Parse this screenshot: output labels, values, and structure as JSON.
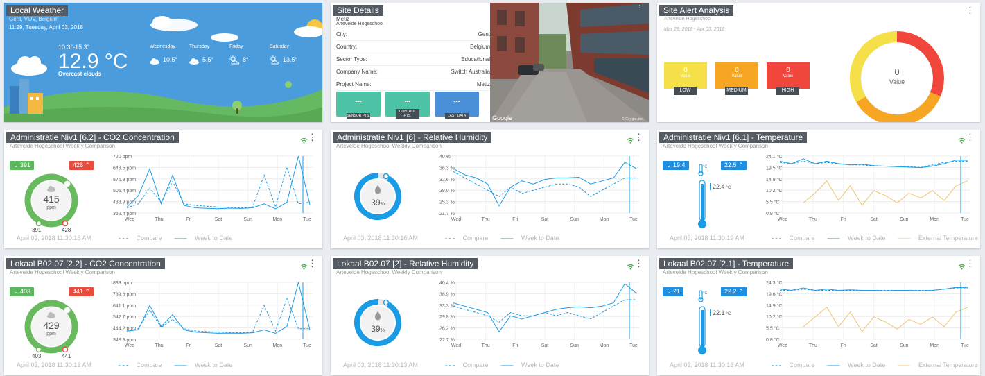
{
  "weather": {
    "title": "Local Weather",
    "location": "Gent, VOV, Belgium",
    "datetime": "11:29, Tuesday, April 03, 2018",
    "range": "10.3°-15.3°",
    "temp": "12.9 °C",
    "condition": "Overcast clouds",
    "forecast": [
      {
        "day": "Wednesday",
        "temp": "10.5°",
        "icon": "cloud-icon"
      },
      {
        "day": "Thursday",
        "temp": "5.5°",
        "icon": "cloud-icon"
      },
      {
        "day": "Friday",
        "temp": "8°",
        "icon": "sun-cloud-icon"
      },
      {
        "day": "Saturday",
        "temp": "13.5°",
        "icon": "sun-cloud-icon"
      }
    ],
    "colors": {
      "sky": "#4a9cdc",
      "grass": "#65b960"
    }
  },
  "site_details": {
    "title": "Site Details",
    "name": "Metiz",
    "subname": "Artevelde Hogeschool",
    "rows": [
      {
        "label": "City:",
        "value": "Gent"
      },
      {
        "label": "Country:",
        "value": "Belgium"
      },
      {
        "label": "Sector Type:",
        "value": "Educational"
      },
      {
        "label": "Company Name:",
        "value": "Switch Australia"
      },
      {
        "label": "Project Name:",
        "value": "Metiz"
      }
    ],
    "buttons": [
      {
        "value": "---",
        "label": "SENSOR PTS.",
        "color": "#4cc3a4"
      },
      {
        "value": "---",
        "label": "CONTROL PTS.",
        "color": "#4cc3a4"
      },
      {
        "value": "---",
        "label": "LAST DATA",
        "color": "#4a90d9"
      }
    ],
    "map_credit": "Google",
    "map_copyright": "© Google, Inc."
  },
  "alerts": {
    "title": "Site Alert Analysis",
    "subtitle": "Artevelde Hogeschool",
    "daterange": "Mar 28, 2018 - Apr 03, 2018",
    "boxes": [
      {
        "value": "0",
        "sub": "Value",
        "label": "LOW",
        "color": "#f5e04a"
      },
      {
        "value": "0",
        "sub": "Value",
        "label": "MEDIUM",
        "color": "#f7a623"
      },
      {
        "value": "0",
        "sub": "Value",
        "label": "HIGH",
        "color": "#f0463c"
      }
    ],
    "donut_value": "0",
    "donut_label": "Value"
  },
  "legend": {
    "compare": "Compare",
    "week": "Week to Date",
    "external": "External Temperature"
  },
  "days": [
    "Wed",
    "Thu",
    "Fri",
    "Sat",
    "Sun",
    "Mon",
    "Tue"
  ],
  "widgets": [
    {
      "title": "Administratie Niv1 [6.2] - CO2 Concentration",
      "subtitle": "Artevelde Hogeschool Weekly Comparison",
      "min": "391",
      "max": "428",
      "value": "415",
      "unit": "ppm",
      "low": "391",
      "high": "428",
      "timestamp": "April 03, 2018 11:30:16 AM",
      "yticks": [
        "720 ppm",
        "648.5 ppm",
        "576.9 ppm",
        "505.4 ppm",
        "433.9 ppm",
        "362.4 ppm"
      ]
    },
    {
      "title": "Administratie Niv1 [6] - Relative Humidity",
      "subtitle": "Artevelde Hogeschool Weekly Comparison",
      "value": "39",
      "unit": "%",
      "gauge_fraction": 0.39,
      "timestamp": "April 03, 2018 11:30:16 AM",
      "yticks": [
        "40 %",
        "36.3 %",
        "32.6 %",
        "29.0 %",
        "25.3 %",
        "21.7 %"
      ]
    },
    {
      "title": "Administratie Niv1 [6.1] - Temperature",
      "subtitle": "Artevelde Hogeschool Weekly Comparison",
      "min": "19.4",
      "max": "22.5",
      "value": "22.4",
      "unit": "°C",
      "timestamp": "April 03, 2018 11:30:19 AM",
      "yticks": [
        "24.1 °C",
        "19.5 °C",
        "14.8 °C",
        "10.2 °C",
        "5.5 °C",
        "0.9 °C"
      ]
    },
    {
      "title": "Lokaal B02.07 [2.2] - CO2 Concentration",
      "subtitle": "Artevelde Hogeschool Weekly Comparison",
      "min": "403",
      "max": "441",
      "value": "429",
      "unit": "ppm",
      "low": "403",
      "high": "441",
      "timestamp": "April 03, 2018 11:30:13 AM",
      "yticks": [
        "838 ppm",
        "739.6 ppm",
        "641.1 ppm",
        "542.7 ppm",
        "444.2 ppm",
        "348.8 ppm"
      ]
    },
    {
      "title": "Lokaal B02.07 [2] - Relative Humidity",
      "subtitle": "Artevelde Hogeschool Weekly Comparison",
      "value": "39",
      "unit": "%",
      "gauge_fraction": 0.39,
      "timestamp": "April 03, 2018 11:30:13 AM",
      "yticks": [
        "40.4 %",
        "36.9 %",
        "33.3 %",
        "29.8 %",
        "26.2 %",
        "22.7 %"
      ]
    },
    {
      "title": "Lokaal B02.07 [2.1] - Temperature",
      "subtitle": "Artevelde Hogeschool Weekly Comparison",
      "min": "21",
      "max": "22.2",
      "value": "22.1",
      "unit": "°C",
      "timestamp": "April 03, 2018 11:30:16 AM",
      "yticks": [
        "24.3 °C",
        "19.6 °C",
        "14.9 °C",
        "10.2 °C",
        "5.5 °C",
        "0.8 °C"
      ]
    }
  ],
  "chart_data": [
    {
      "type": "line",
      "title": "Administratie Niv1 [6.2] - CO2 Concentration",
      "x": [
        "Wed",
        "Thu",
        "Fri",
        "Sat",
        "Sun",
        "Mon",
        "Tue"
      ],
      "ylim": [
        362.4,
        720
      ],
      "series": [
        {
          "name": "Week to Date",
          "values": [
            400,
            470,
            640,
            420,
            600,
            410,
            395,
            392,
            390,
            393,
            391,
            395,
            420,
            389,
            430,
            720,
            415
          ]
        },
        {
          "name": "Compare",
          "values": [
            395,
            420,
            520,
            430,
            560,
            420,
            410,
            405,
            400,
            398,
            395,
            400,
            600,
            400,
            650,
            420,
            430
          ]
        }
      ]
    },
    {
      "type": "line",
      "title": "Administratie Niv1 [6] - Relative Humidity",
      "x": [
        "Wed",
        "Thu",
        "Fri",
        "Sat",
        "Sun",
        "Mon",
        "Tue"
      ],
      "ylim": [
        21.7,
        40
      ],
      "series": [
        {
          "name": "Week to Date",
          "values": [
            36,
            34,
            33,
            31,
            24,
            30,
            32,
            31,
            32.5,
            33,
            33,
            33.2,
            31,
            32,
            33,
            38,
            36
          ]
        },
        {
          "name": "Compare",
          "values": [
            35,
            33,
            31,
            29,
            27,
            30,
            28,
            29,
            30,
            31,
            31,
            30,
            27,
            29,
            31,
            33,
            33
          ]
        }
      ]
    },
    {
      "type": "line",
      "title": "Administratie Niv1 [6.1] - Temperature",
      "x": [
        "Wed",
        "Thu",
        "Fri",
        "Sat",
        "Sun",
        "Mon",
        "Tue"
      ],
      "ylim": [
        0.9,
        24.1
      ],
      "series": [
        {
          "name": "Week to Date",
          "values": [
            22,
            21,
            23,
            21,
            22,
            21,
            20.5,
            20.8,
            20.2,
            20,
            19.8,
            19.6,
            19.4,
            20,
            21,
            22.5,
            22.4
          ]
        },
        {
          "name": "Compare",
          "values": [
            21.5,
            21,
            22,
            21,
            21.5,
            21,
            20.5,
            20.5,
            20,
            20,
            19.8,
            19.8,
            19.5,
            20.5,
            21.5,
            22,
            22
          ]
        },
        {
          "name": "External Temperature",
          "values": [
            null,
            null,
            5,
            9,
            14,
            6,
            12,
            4,
            10,
            8,
            5,
            9,
            7,
            10,
            6,
            12,
            14
          ]
        }
      ]
    },
    {
      "type": "line",
      "title": "Lokaal B02.07 [2.2] - CO2 Concentration",
      "x": [
        "Wed",
        "Thu",
        "Fri",
        "Sat",
        "Sun",
        "Mon",
        "Tue"
      ],
      "ylim": [
        348.8,
        838
      ],
      "series": [
        {
          "name": "Week to Date",
          "values": [
            420,
            430,
            640,
            460,
            560,
            430,
            410,
            405,
            400,
            402,
            400,
            405,
            430,
            400,
            460,
            838,
            429
          ]
        },
        {
          "name": "Compare",
          "values": [
            420,
            440,
            600,
            450,
            520,
            440,
            420,
            415,
            410,
            408,
            405,
            410,
            640,
            420,
            700,
            440,
            440
          ]
        }
      ]
    },
    {
      "type": "line",
      "title": "Lokaal B02.07 [2] - Relative Humidity",
      "x": [
        "Wed",
        "Thu",
        "Fri",
        "Sat",
        "Sun",
        "Mon",
        "Tue"
      ],
      "ylim": [
        22.7,
        40.4
      ],
      "series": [
        {
          "name": "Week to Date",
          "values": [
            34,
            33,
            32,
            31,
            25,
            30,
            29,
            30,
            31,
            32,
            32.5,
            32.8,
            32.5,
            33,
            34,
            40,
            37
          ]
        },
        {
          "name": "Compare",
          "values": [
            33,
            32,
            31,
            30,
            28,
            31,
            30,
            30,
            31,
            30,
            31,
            30,
            29,
            31,
            33,
            35,
            35
          ]
        }
      ]
    },
    {
      "type": "line",
      "title": "Lokaal B02.07 [2.1] - Temperature",
      "x": [
        "Wed",
        "Thu",
        "Fri",
        "Sat",
        "Sun",
        "Mon",
        "Tue"
      ],
      "ylim": [
        0.8,
        24.3
      ],
      "series": [
        {
          "name": "Week to Date",
          "values": [
            21.5,
            21,
            22,
            21,
            21.5,
            21,
            21.2,
            21,
            21,
            20.8,
            21,
            21,
            20.8,
            21,
            21.5,
            22.2,
            22.1
          ]
        },
        {
          "name": "Compare",
          "values": [
            21,
            21,
            21.5,
            21,
            21,
            21,
            21,
            21,
            21,
            21,
            21,
            21,
            21,
            21,
            21.5,
            22,
            22
          ]
        },
        {
          "name": "External Temperature",
          "values": [
            null,
            null,
            6,
            10,
            14,
            6,
            12,
            4,
            10,
            8,
            5,
            9,
            7,
            10,
            6,
            12,
            14
          ]
        }
      ]
    }
  ]
}
